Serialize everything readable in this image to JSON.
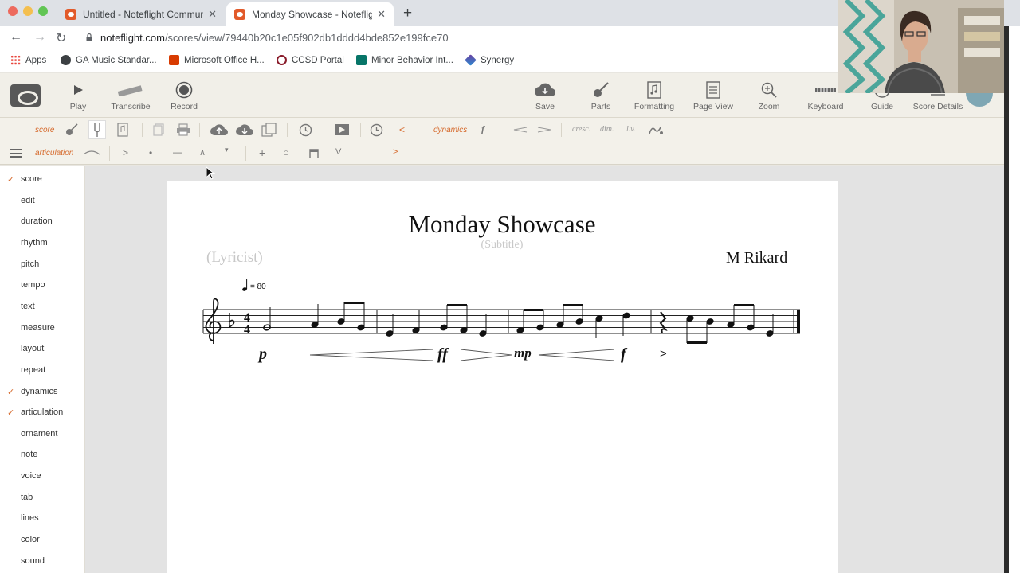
{
  "browser": {
    "tabs": [
      {
        "title": "Untitled - Noteflight Communi",
        "close": "✕"
      },
      {
        "title": "Monday Showcase - Noteflight",
        "close": "✕"
      }
    ],
    "new_tab": "+",
    "url_host": "noteflight.com",
    "url_path": "/scores/view/79440b20c1e05f902db1dddd4bde852e199fce70",
    "bookmarks": [
      "Apps",
      "GA Music Standar...",
      "Microsoft Office H...",
      "CCSD Portal",
      "Minor Behavior Int...",
      "Synergy"
    ]
  },
  "toolbar": {
    "left": [
      "Play",
      "Transcribe",
      "Record"
    ],
    "right": [
      "Save",
      "Parts",
      "Formatting",
      "Page View",
      "Zoom",
      "Keyboard",
      "Guide",
      "Score Details"
    ]
  },
  "palette": {
    "row1_label": "score",
    "row1_dynamics_label": "dynamics",
    "row1_symbols": [
      "<",
      "f",
      "cresc.",
      "dim.",
      "l.v."
    ],
    "row2_label": "articulation",
    "row2_symbols": [
      ">",
      "•",
      "—",
      "∧",
      "▾",
      "+",
      "○",
      "V",
      ">"
    ]
  },
  "sidebar": {
    "items": [
      {
        "label": "score",
        "checked": true
      },
      {
        "label": "edit",
        "checked": false
      },
      {
        "label": "duration",
        "checked": false
      },
      {
        "label": "rhythm",
        "checked": false
      },
      {
        "label": "pitch",
        "checked": false
      },
      {
        "label": "tempo",
        "checked": false
      },
      {
        "label": "text",
        "checked": false
      },
      {
        "label": "measure",
        "checked": false
      },
      {
        "label": "layout",
        "checked": false
      },
      {
        "label": "repeat",
        "checked": false
      },
      {
        "label": "dynamics",
        "checked": true
      },
      {
        "label": "articulation",
        "checked": true
      },
      {
        "label": "ornament",
        "checked": false
      },
      {
        "label": "note",
        "checked": false
      },
      {
        "label": "voice",
        "checked": false
      },
      {
        "label": "tab",
        "checked": false
      },
      {
        "label": "lines",
        "checked": false
      },
      {
        "label": "color",
        "checked": false
      },
      {
        "label": "sound",
        "checked": false
      }
    ],
    "check_glyph": "✓"
  },
  "score": {
    "title": "Monday Showcase",
    "subtitle": "(Subtitle)",
    "lyricist": "(Lyricist)",
    "composer": "M Rikard",
    "tempo": "= 80",
    "time_signature": "4/4",
    "dynamics": [
      "p",
      "ff",
      "mp",
      "f"
    ],
    "accent": ">"
  }
}
